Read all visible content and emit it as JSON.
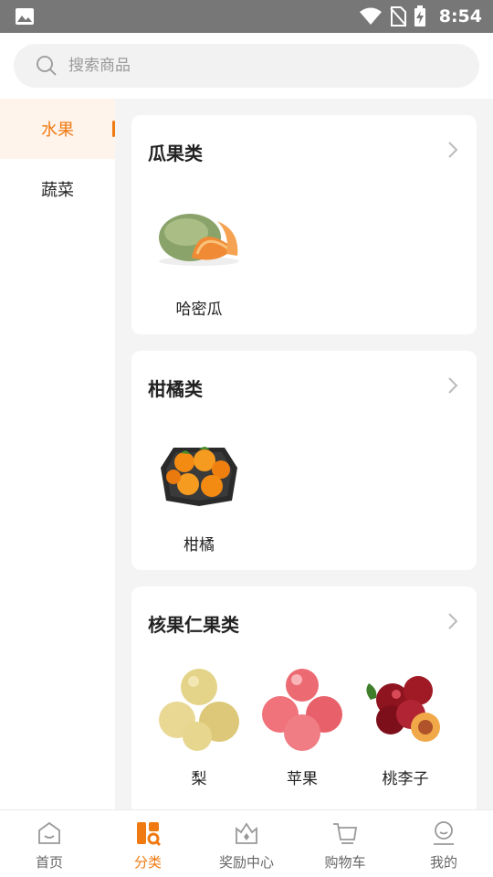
{
  "status_bar": {
    "time": "8:54"
  },
  "search": {
    "placeholder": "搜索商品"
  },
  "sidebar": {
    "items": [
      {
        "label": "水果",
        "active": true
      },
      {
        "label": "蔬菜",
        "active": false
      }
    ]
  },
  "sections": [
    {
      "title": "瓜果类",
      "products": [
        {
          "name": "哈密瓜"
        }
      ]
    },
    {
      "title": "柑橘类",
      "products": [
        {
          "name": "柑橘"
        }
      ]
    },
    {
      "title": "核果仁果类",
      "products": [
        {
          "name": "梨"
        },
        {
          "name": "苹果"
        },
        {
          "name": "桃李子"
        }
      ]
    }
  ],
  "tabbar": {
    "items": [
      {
        "label": "首页",
        "icon": "home-icon"
      },
      {
        "label": "分类",
        "icon": "category-icon",
        "active": true
      },
      {
        "label": "奖励中心",
        "icon": "reward-icon"
      },
      {
        "label": "购物车",
        "icon": "cart-icon"
      },
      {
        "label": "我的",
        "icon": "profile-icon"
      }
    ]
  },
  "colors": {
    "accent": "#f07a12",
    "status_bar": "#777777",
    "background": "#f4f4f4"
  }
}
